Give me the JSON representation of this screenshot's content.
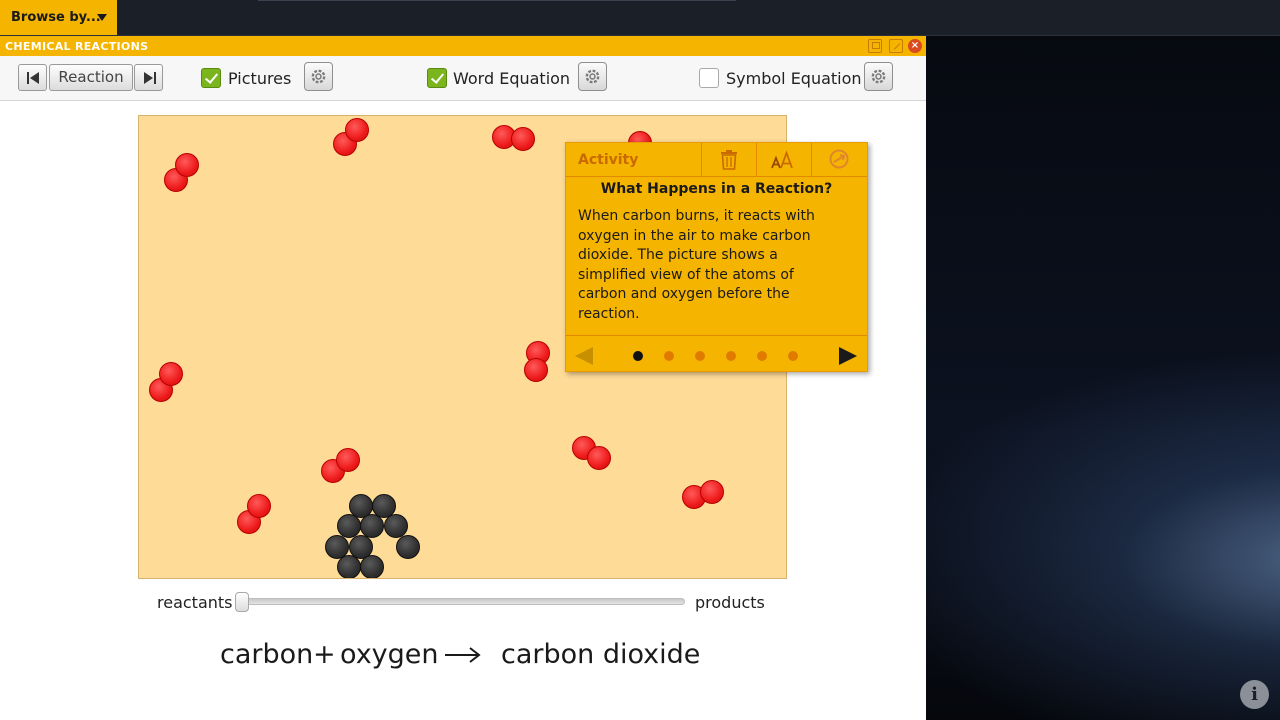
{
  "topbar": {
    "browse_label": "Browse by..."
  },
  "window": {
    "title": "CHEMICAL REACTIONS",
    "close_glyph": "×"
  },
  "toolbar": {
    "reaction_label": "Reaction",
    "pictures": {
      "label": "Pictures",
      "checked": true
    },
    "word_equation": {
      "label": "Word Equation",
      "checked": true
    },
    "symbol_equation": {
      "label": "Symbol Equation",
      "checked": false
    }
  },
  "activity": {
    "header": "Activity",
    "heading": "What Happens in a Reaction?",
    "body": "When carbon burns, it reacts with oxygen in the air to make carbon dioxide. The picture shows a simplified view of the atoms of carbon and oxygen before the reaction.",
    "pages": 6,
    "current_page": 1
  },
  "slider": {
    "left_label": "reactants",
    "right_label": "products",
    "value": 0
  },
  "equation": {
    "reactant1": "carbon",
    "plus": "+",
    "reactant2": "oxygen",
    "product": "carbon dioxide"
  },
  "info": {
    "glyph": "i"
  },
  "colors": {
    "accent": "#f5b400",
    "oxygen_atom": "#ee1a1a",
    "carbon_atom": "#2f2f2f",
    "canvas_bg": "#fedb97",
    "checkbox_on": "#7ab51d"
  },
  "icons": [
    "chevron-down-icon",
    "step-back-icon",
    "step-forward-icon",
    "settings-gear-icon",
    "trash-icon",
    "text-size-icon",
    "hide-icon",
    "arrow-left-icon",
    "arrow-right-icon",
    "info-icon",
    "close-icon",
    "restore-icon",
    "popout-icon"
  ]
}
